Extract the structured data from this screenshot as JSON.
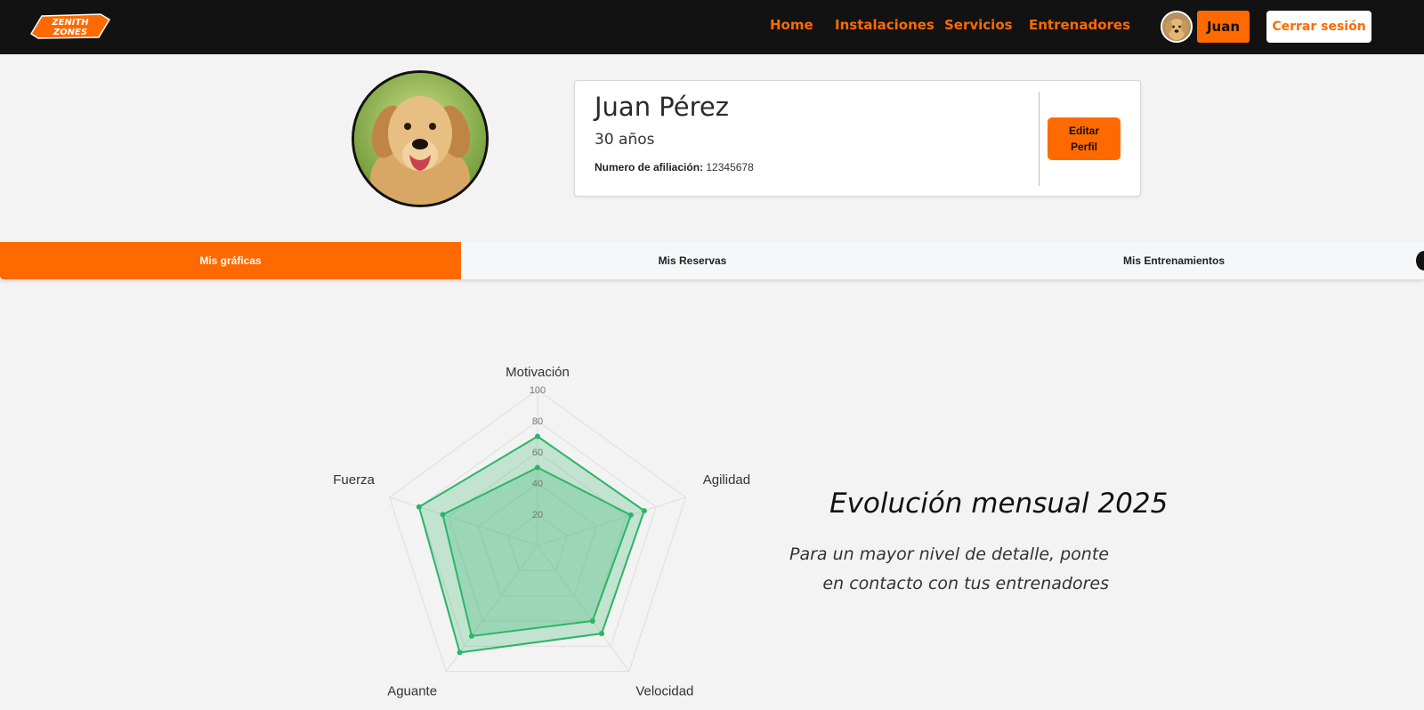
{
  "header": {
    "logo_text": "ZENITHZONES",
    "nav": [
      "Home",
      "Instalaciones",
      "Servicios",
      "Entrenadores"
    ],
    "user_button": "Juan",
    "logout_button": "Cerrar sesión",
    "brand_color": "#ff6a00"
  },
  "profile": {
    "name": "Juan Pérez",
    "age": "30 años",
    "affiliation_label": "Numero de afiliación:",
    "affiliation_number": "12345678",
    "edit_button": "Editar\nPerfil"
  },
  "tabs": [
    {
      "label": "Mis gráficas",
      "active": true
    },
    {
      "label": "Mis Reservas",
      "active": false
    },
    {
      "label": "Mis Entrenamientos",
      "active": false
    }
  ],
  "chart_data": {
    "type": "radar",
    "axes": [
      "Motivación",
      "Agilidad",
      "Velocidad",
      "Aguante",
      "Fuerza"
    ],
    "ticks": [
      20,
      40,
      60,
      80,
      100
    ],
    "range": [
      0,
      100
    ],
    "grid": true,
    "fill_color": "#2bb566",
    "series": [
      {
        "values": [
          70,
          72,
          70,
          85,
          80
        ]
      },
      {
        "values": [
          50,
          63,
          60,
          72,
          64
        ]
      }
    ]
  },
  "evolution": {
    "title": "Evolución mensual 2025",
    "text": "Para un mayor nivel de detalle, ponte\nen contacto con tus entrenadores"
  }
}
